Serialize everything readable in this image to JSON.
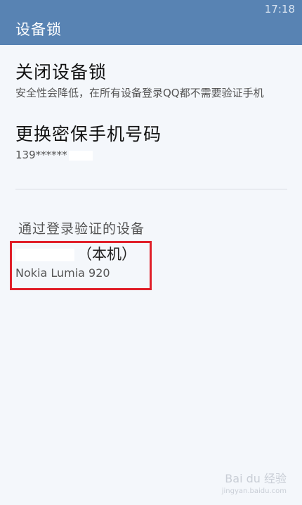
{
  "status": {
    "time": "17:18"
  },
  "header": {
    "title": "设备锁"
  },
  "settings": {
    "close_lock": {
      "title": "关闭设备锁",
      "subtitle": "安全性会降低，在所有设备登录QQ都不需要验证手机"
    },
    "change_phone": {
      "title": "更换密保手机号码",
      "phone": "139******"
    }
  },
  "devices": {
    "section_title": "通过登录验证的设备",
    "items": [
      {
        "name_suffix": "（本机）",
        "model": "Nokia Lumia 920"
      }
    ]
  },
  "watermark": {
    "text": "Bai du 经验",
    "sub": "jingyan.baidu.com"
  }
}
